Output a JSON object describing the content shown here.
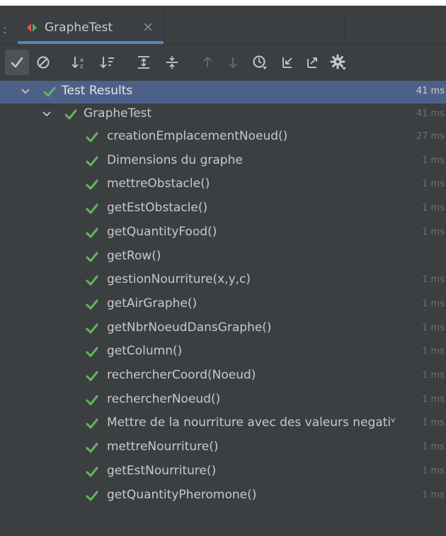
{
  "tab": {
    "label": "GrapheTest",
    "close": "×",
    "separator": ":",
    "icon": "run-config-icon"
  },
  "toolbar": {
    "buttons": [
      {
        "name": "show-passed-button",
        "icon": "check-icon",
        "active": true
      },
      {
        "name": "show-ignored-button",
        "icon": "ignored-icon",
        "active": false
      },
      {
        "name": "sort-alpha-button",
        "icon": "sort-alpha-icon",
        "active": false
      },
      {
        "name": "sort-duration-button",
        "icon": "sort-duration-icon",
        "active": false
      },
      {
        "name": "expand-all-button",
        "icon": "expand-all-icon",
        "active": false
      },
      {
        "name": "collapse-all-button",
        "icon": "collapse-all-icon",
        "active": false
      },
      {
        "name": "previous-failed-button",
        "icon": "arrow-up-icon",
        "active": false
      },
      {
        "name": "next-failed-button",
        "icon": "arrow-down-icon",
        "active": false
      },
      {
        "name": "test-history-button",
        "icon": "history-icon",
        "active": false
      },
      {
        "name": "import-tests-button",
        "icon": "import-icon",
        "active": false
      },
      {
        "name": "export-tests-button",
        "icon": "export-icon",
        "active": false
      },
      {
        "name": "settings-button",
        "icon": "gear-icon",
        "active": false
      }
    ]
  },
  "tree": {
    "root": {
      "label": "Test Results",
      "duration": "41 ms"
    },
    "suite": {
      "label": "GrapheTest",
      "duration": "41 ms"
    },
    "tests": [
      {
        "label": "creationEmplacementNoeud()",
        "duration": "27 ms"
      },
      {
        "label": "Dimensions du graphe",
        "duration": "1 ms"
      },
      {
        "label": "mettreObstacle()",
        "duration": "1 ms"
      },
      {
        "label": "getEstObstacle()",
        "duration": "1 ms"
      },
      {
        "label": "getQuantityFood()",
        "duration": "1 ms"
      },
      {
        "label": "getRow()",
        "duration": ""
      },
      {
        "label": "gestionNourriture(x,y,c)",
        "duration": "1 ms"
      },
      {
        "label": "getAirGraphe()",
        "duration": "1 ms"
      },
      {
        "label": "getNbrNoeudDansGraphe()",
        "duration": "1 ms"
      },
      {
        "label": "getColumn()",
        "duration": "1 ms"
      },
      {
        "label": "rechercherCoord(Noeud)",
        "duration": "1 ms"
      },
      {
        "label": "rechercherNoeud()",
        "duration": "1 ms"
      },
      {
        "label": "Mettre de la nourriture avec des valeurs negatiᵛ",
        "duration": "1 ms"
      },
      {
        "label": "mettreNourriture()",
        "duration": "1 ms"
      },
      {
        "label": "getEstNourriture()",
        "duration": "1 ms"
      },
      {
        "label": "getQuantityPheromone()",
        "duration": "1 ms"
      }
    ]
  },
  "colors": {
    "background": "#3c3f41",
    "selection": "#4d6088",
    "passed_green": "#5fb85a",
    "tab_underline": "#4a88c7",
    "duration_text": "#6e6e6e"
  }
}
